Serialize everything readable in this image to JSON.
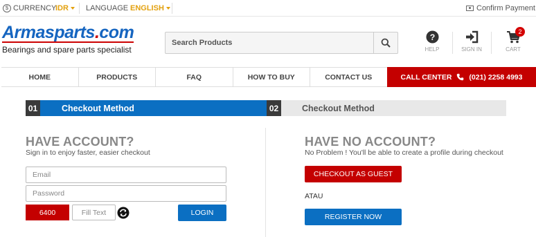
{
  "topbar": {
    "currency_label": "CURRENCY",
    "currency_value": "IDR",
    "language_label": "LANGUAGE",
    "language_value": "ENGLISH",
    "confirm_payment": "Confirm Payment"
  },
  "logo": {
    "name_part1": "Armasparts",
    "name_dot": ".",
    "name_part2": "com",
    "tagline": "Bearings and spare parts specialist"
  },
  "search": {
    "placeholder": "Search Products"
  },
  "header_icons": {
    "help": "HELP",
    "sign_in": "SIGN IN",
    "cart": "CART",
    "cart_count": "2"
  },
  "nav": {
    "items": [
      "HOME",
      "PRODUCTS",
      "FAQ",
      "HOW TO BUY",
      "CONTACT US"
    ],
    "call_center_label": "CALL CENTER",
    "call_center_phone": "(021) 2258 4993"
  },
  "steps": [
    {
      "num": "01",
      "label": "Checkout Method"
    },
    {
      "num": "02",
      "label": "Checkout Method"
    }
  ],
  "have_account": {
    "title": "HAVE ACCOUNT?",
    "subtitle": "Sign in to enjoy faster, easier checkout",
    "email_placeholder": "Email",
    "password_placeholder": "Password",
    "captcha_code": "6400",
    "captcha_placeholder": "Fill Text",
    "login_label": "LOGIN"
  },
  "no_account": {
    "title": "HAVE NO ACCOUNT?",
    "subtitle": "No Problem ! You'll be able to create a profile during checkout",
    "guest_label": "CHECKOUT AS GUEST",
    "atau": "ATAU",
    "register_label": "REGISTER NOW"
  },
  "colors": {
    "brand_blue": "#0b6fc2",
    "brand_red": "#c40000",
    "accent_gold": "#e3a10f"
  }
}
